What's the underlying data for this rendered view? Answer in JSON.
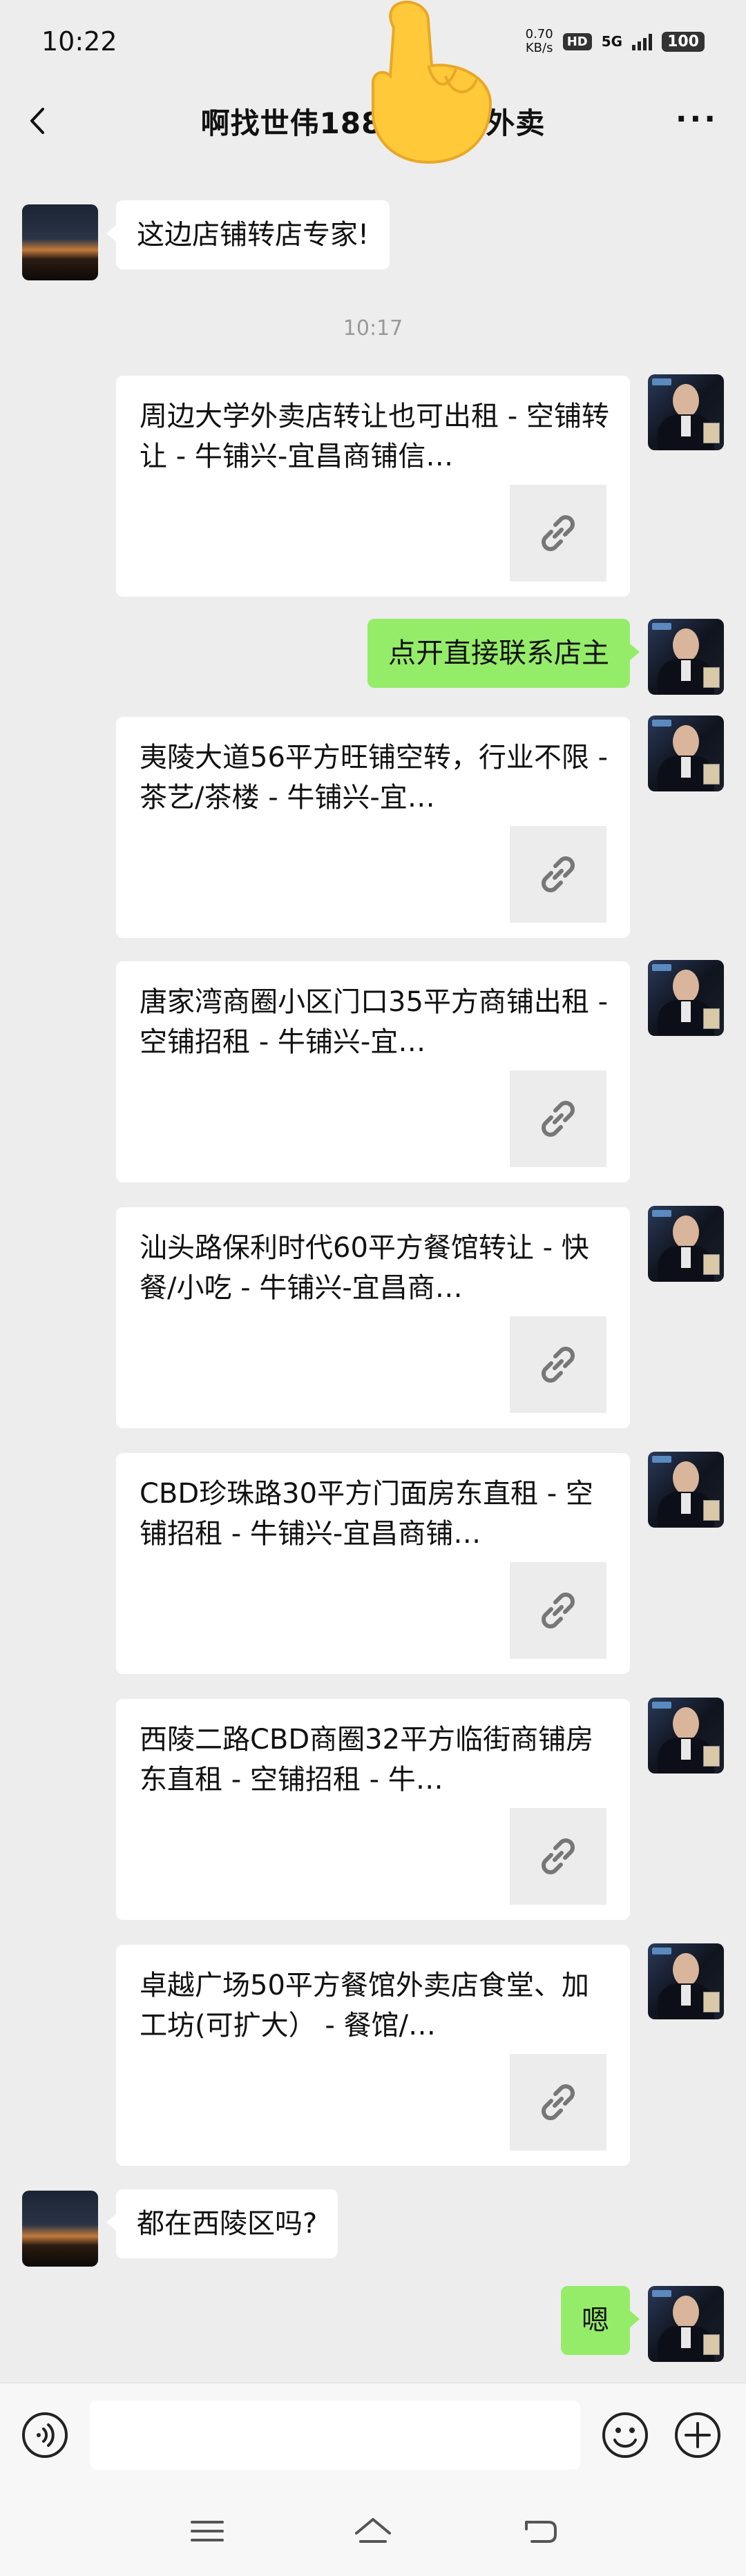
{
  "status_bar": {
    "time": "10:22",
    "net_speed_value": "0.70",
    "net_speed_unit": "KB/s",
    "hd": "HD",
    "network": "5G",
    "battery": "100"
  },
  "header": {
    "title": "啊找世伟188",
    "title_suffix": "外卖"
  },
  "messages": {
    "m1_text": "这边店铺转店专家!",
    "time1": "10:17",
    "card1": "周边大学外卖店转让也可出租 - 空铺转让 - 牛铺兴-宜昌商铺信…",
    "m2_text": "点开直接联系店主",
    "card2": "夷陵大道56平方旺铺空转，行业不限 - 茶艺/茶楼 - 牛铺兴-宜…",
    "card3": "唐家湾商圈小区门口35平方商铺出租 - 空铺招租 - 牛铺兴-宜…",
    "card4": "汕头路保利时代60平方餐馆转让 - 快餐/小吃 - 牛铺兴-宜昌商…",
    "card5": "CBD珍珠路30平方门面房东直租 - 空铺招租 - 牛铺兴-宜昌商铺…",
    "card6": "西陵二路CBD商圈32平方临街商铺房东直租 - 空铺招租 - 牛…",
    "card7": "卓越广场50平方餐馆外卖店食堂、加工坊(可扩大） - 餐馆/…",
    "m3_text": "都在西陵区吗?",
    "m4_text": "嗯"
  },
  "input": {
    "placeholder": ""
  }
}
